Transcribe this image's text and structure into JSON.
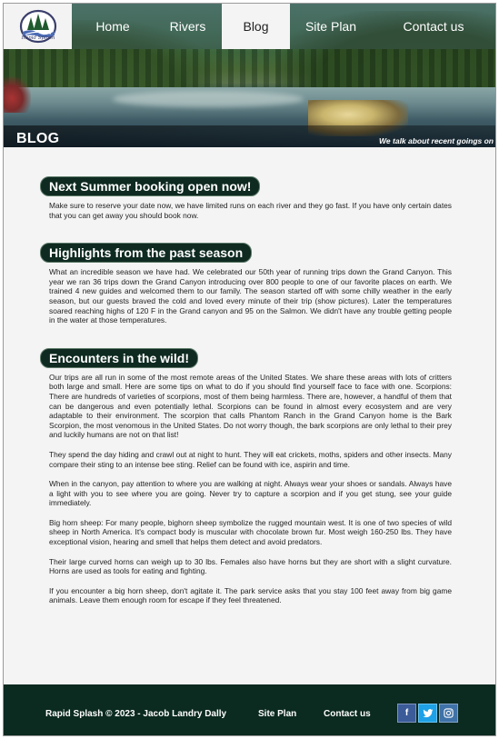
{
  "brand": {
    "logo_text": "Rapid Splash",
    "logo_colors": {
      "tree": "#1f5a2e",
      "ring": "#3a3f6b",
      "water": "#4c6bb5"
    }
  },
  "nav": {
    "items": [
      {
        "label": "Home",
        "active": false
      },
      {
        "label": "Rivers",
        "active": false
      },
      {
        "label": "Blog",
        "active": true
      },
      {
        "label": "Site Plan",
        "active": false
      },
      {
        "label": "Contact us",
        "active": false
      }
    ]
  },
  "hero": {
    "heading": "BLOG",
    "tagline": "We talk about recent goings on"
  },
  "sections": [
    {
      "title": "Next Summer booking open now!",
      "paragraphs": [
        "Make sure to reserve your date now, we have limited runs on each river and they go fast. If you have only certain dates that you can get away you should book now."
      ]
    },
    {
      "title": "Highlights from the past season",
      "paragraphs": [
        "What an incredible season we have had. We celebrated our 50th year of running trips down the Grand Canyon. This year we ran 36 trips down the Grand Canyon introducing over 800 people to one of our favorite places on earth. We trained 4 new guides and welcomed them to our family. The season started off with some chilly weather in the early season, but our guests braved the cold and loved every minute of their trip (show pictures). Later the temperatures soared reaching highs of 120 F in the Grand canyon and 95 on the Salmon. We didn't have any trouble getting people in the water at those temperatures."
      ]
    },
    {
      "title": "Encounters in the wild!",
      "paragraphs": [
        "Our trips are all run in some of the most remote areas of the United States. We share these areas with lots of critters both large and small. Here are some tips on what to do if you should find yourself face to face with one. Scorpions: There are hundreds of varieties of scorpions, most of them being harmless. There are, however, a handful of them that can be dangerous and even potentially lethal. Scorpions can be found in almost every ecosystem and are very adaptable to their environment. The scorpion that calls Phantom Ranch in the Grand Canyon home is the Bark Scorpion, the most venomous in the United States. Do not worry though, the bark scorpions are only lethal to their prey and luckily humans are not on that list!",
        "They spend the day hiding and crawl out at night to hunt. They will eat crickets, moths, spiders and other insects. Many compare their sting to an intense bee sting. Relief can be found with ice, aspirin and time.",
        "When in the canyon, pay attention to where you are walking at night. Always wear your shoes or sandals. Always have a light with you to see where you are going. Never try to capture a scorpion and if you get stung, see your guide immediately.",
        "Big horn sheep: For many people, bighorn sheep symbolize the rugged mountain west. It is one of two species of wild sheep in North America. It's compact body is muscular with chocolate brown fur. Most weigh 160-250 lbs. They have exceptional vision, hearing and smell that helps them detect and avoid predators.",
        "Their large curved horns can weigh up to 30 lbs. Females also have horns but they are short with a slight curvature. Horns are used as tools for eating and fighting.",
        "If you encounter a big horn sheep, don't agitate it. The park service asks that you stay 100 feet away from big game animals. Leave them enough room for escape if they feel threatened."
      ]
    }
  ],
  "footer": {
    "copyright": "Rapid Splash © 2023 - Jacob Landry Dally",
    "site_plan": "Site Plan",
    "contact": "Contact us",
    "social": [
      {
        "icon": "facebook-icon",
        "glyph": "f",
        "color": "#3b5b99"
      },
      {
        "icon": "twitter-icon",
        "glyph": "🐦",
        "color": "#1ea1e6"
      },
      {
        "icon": "instagram-icon",
        "glyph": "◎",
        "color": "#3f72a8"
      }
    ]
  }
}
